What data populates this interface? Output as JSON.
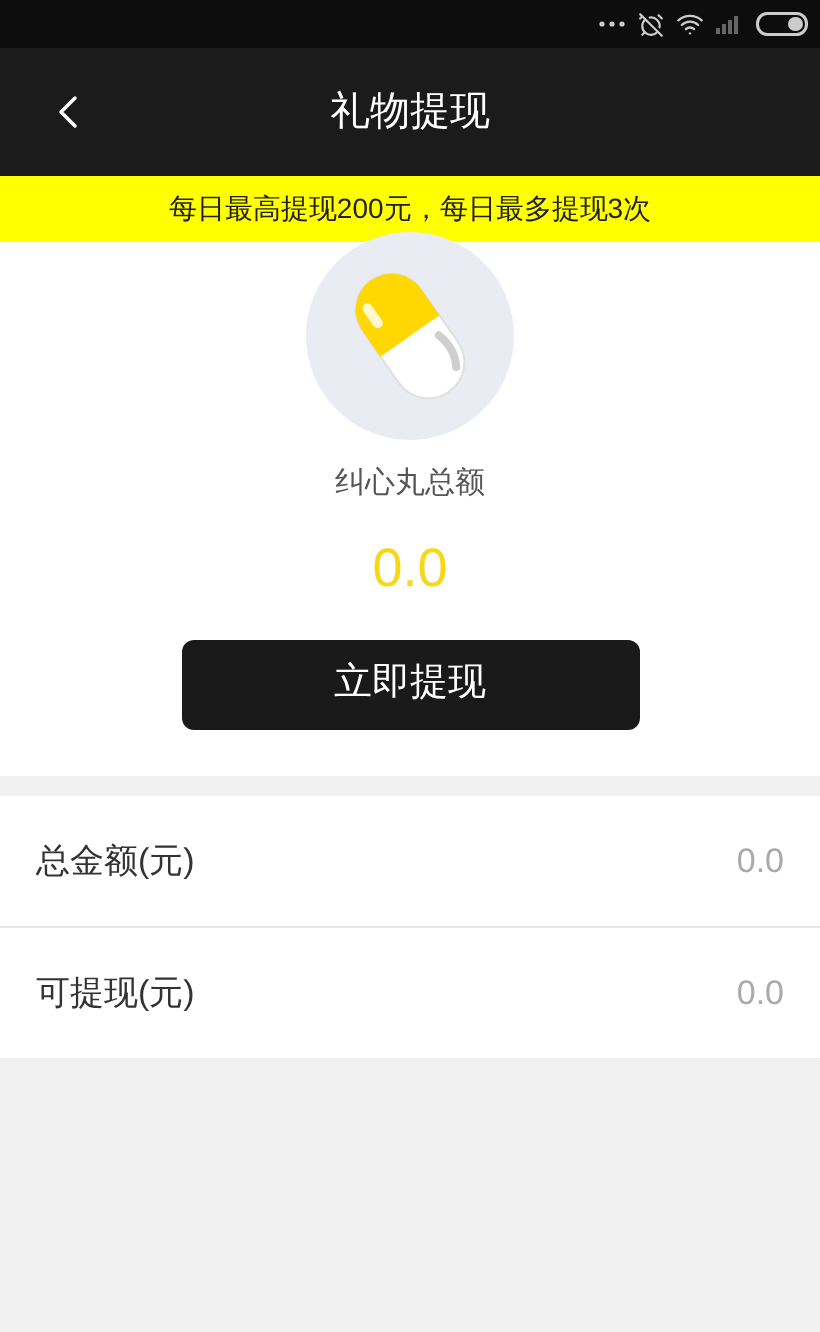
{
  "header": {
    "title": "礼物提现"
  },
  "notice": "每日最高提现200元，每日最多提现3次",
  "balance": {
    "label": "纠心丸总额",
    "value": "0.0"
  },
  "withdraw_button": "立即提现",
  "rows": [
    {
      "label": "总金额(元)",
      "value": "0.0"
    },
    {
      "label": "可提现(元)",
      "value": "0.0"
    }
  ]
}
